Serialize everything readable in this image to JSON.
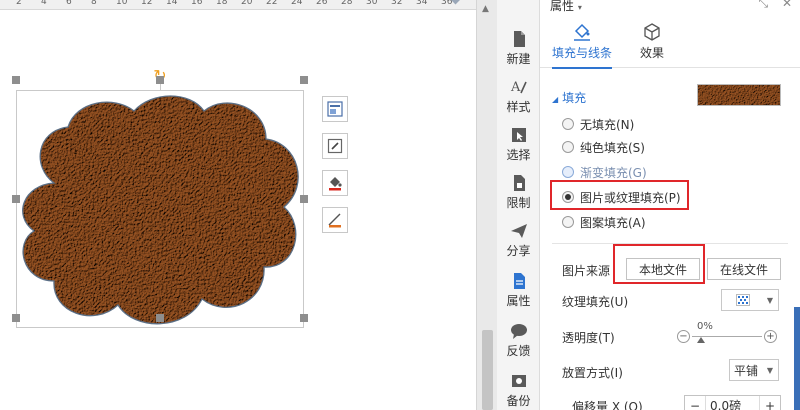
{
  "ruler": {
    "ticks": [
      "2",
      "4",
      "6",
      "8",
      "10",
      "12",
      "14",
      "16",
      "18",
      "20",
      "22",
      "24",
      "26",
      "28",
      "30",
      "32",
      "34",
      "36"
    ]
  },
  "canvas": {
    "rotate_glyph": "↻",
    "float_tools": [
      {
        "icon": "layout-icon"
      },
      {
        "icon": "edit-shape-icon"
      },
      {
        "icon": "fill-bucket-icon"
      },
      {
        "icon": "outline-icon"
      }
    ],
    "texture_color_dark": "#6f3d17",
    "texture_color_light": "#a5622e"
  },
  "sidebar": {
    "items": [
      {
        "label": "新建",
        "icon": "new-file-icon"
      },
      {
        "label": "样式",
        "icon": "style-icon"
      },
      {
        "label": "选择",
        "icon": "select-icon"
      },
      {
        "label": "限制",
        "icon": "restrict-icon"
      },
      {
        "label": "分享",
        "icon": "share-icon"
      },
      {
        "label": "属性",
        "icon": "properties-icon"
      },
      {
        "label": "反馈",
        "icon": "feedback-icon"
      },
      {
        "label": "备份",
        "icon": "backup-icon"
      }
    ]
  },
  "panel": {
    "title": "属性",
    "title_caret": "▾",
    "ctrl_shrink": "⤡",
    "ctrl_close": "✕",
    "tabs": [
      {
        "label": "填充与线条",
        "icon": "fill-line-icon"
      },
      {
        "label": "效果",
        "icon": "effect-cube-icon"
      }
    ],
    "section_title": "填充",
    "section_triangle": "◢",
    "fill_options": [
      {
        "label": "无填充(N)",
        "checked": false
      },
      {
        "label": "纯色填充(S)",
        "checked": false
      },
      {
        "label": "渐变填充(G)",
        "checked": false
      },
      {
        "label": "图片或纹理填充(P)",
        "checked": true
      },
      {
        "label": "图案填充(A)",
        "checked": false
      }
    ],
    "picture_source_label": "图片来源",
    "local_file_button": "本地文件",
    "online_file_button": "在线文件",
    "texture_fill_label": "纹理填充(U)",
    "opacity_label": "透明度(T)",
    "opacity_value": "0%",
    "placement_label": "放置方式(I)",
    "placement_value": "平铺",
    "offset_x_label": "偏移量 X (O)",
    "offset_x_value": "0.0磅",
    "minus": "−",
    "plus": "+",
    "accent_color": "#2e74d0",
    "highlight_color": "#e0262a"
  }
}
